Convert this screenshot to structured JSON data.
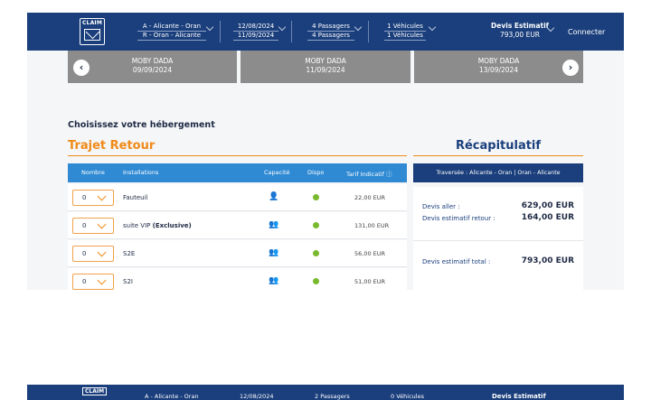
{
  "header": {
    "logo_text": "CLAIM",
    "route_a": "A - Alicante - Oran",
    "route_r": "R - Oran - Alicante",
    "date_out": "12/08/2024",
    "date_back": "11/09/2024",
    "passengers_out": "4 Passagers",
    "passengers_back": "4 Passagers",
    "vehicles_out": "1 Véhicules",
    "vehicles_back": "1 Véhicules",
    "devis_title": "Devis Estimatif",
    "devis_amount": "793,00 EUR",
    "connect_label": "Connecter"
  },
  "ferries": [
    {
      "operator": "MOBY DADA",
      "date": "09/09/2024"
    },
    {
      "operator": "MOBY DADA",
      "date": "11/09/2024"
    },
    {
      "operator": "MOBY DADA",
      "date": "13/09/2024"
    }
  ],
  "nav": {
    "prev": "‹",
    "next": "›"
  },
  "main": {
    "heading": "Choisissez votre hébergement",
    "section_title": "Trajet Retour",
    "columns": [
      "Nombre",
      "Installations",
      "Capacité",
      "Dispo",
      "Tarif Indicatif"
    ],
    "rows": [
      {
        "qty": "0",
        "name": "Fauteuil",
        "name_extra": "",
        "capacity": "👤",
        "price": "22,00 EUR"
      },
      {
        "qty": "0",
        "name": "suite VIP",
        "name_extra": "(Exclusive)",
        "capacity": "👥",
        "price": "131,00 EUR"
      },
      {
        "qty": "0",
        "name": "S2E",
        "name_extra": "",
        "capacity": "👥",
        "price": "56,00 EUR"
      },
      {
        "qty": "0",
        "name": "S2I",
        "name_extra": "",
        "capacity": "👥",
        "price": "51,00 EUR"
      }
    ]
  },
  "recap": {
    "title": "Récapitulatif",
    "header": "Traversée : Alicante - Oran | Oran - Alicante",
    "aller_label": "Devis aller :",
    "aller_value": "629,00 EUR",
    "retour_label": "Devis estimatif retour :",
    "retour_value": "164,00 EUR",
    "total_label": "Devis estimatif total :",
    "total_value": "793,00 EUR"
  },
  "second_header": {
    "logo_text": "CLAIM",
    "route_a": "A - Alicante - Oran",
    "date_out": "12/08/2024",
    "passengers_out": "2 Passagers",
    "vehicles_out": "0 Véhicules",
    "devis_title": "Devis Estimatif"
  },
  "colors": {
    "primary": "#1b3f7c",
    "accent": "#f08a18",
    "table_header": "#2f8ad3",
    "available": "#79b92e"
  }
}
